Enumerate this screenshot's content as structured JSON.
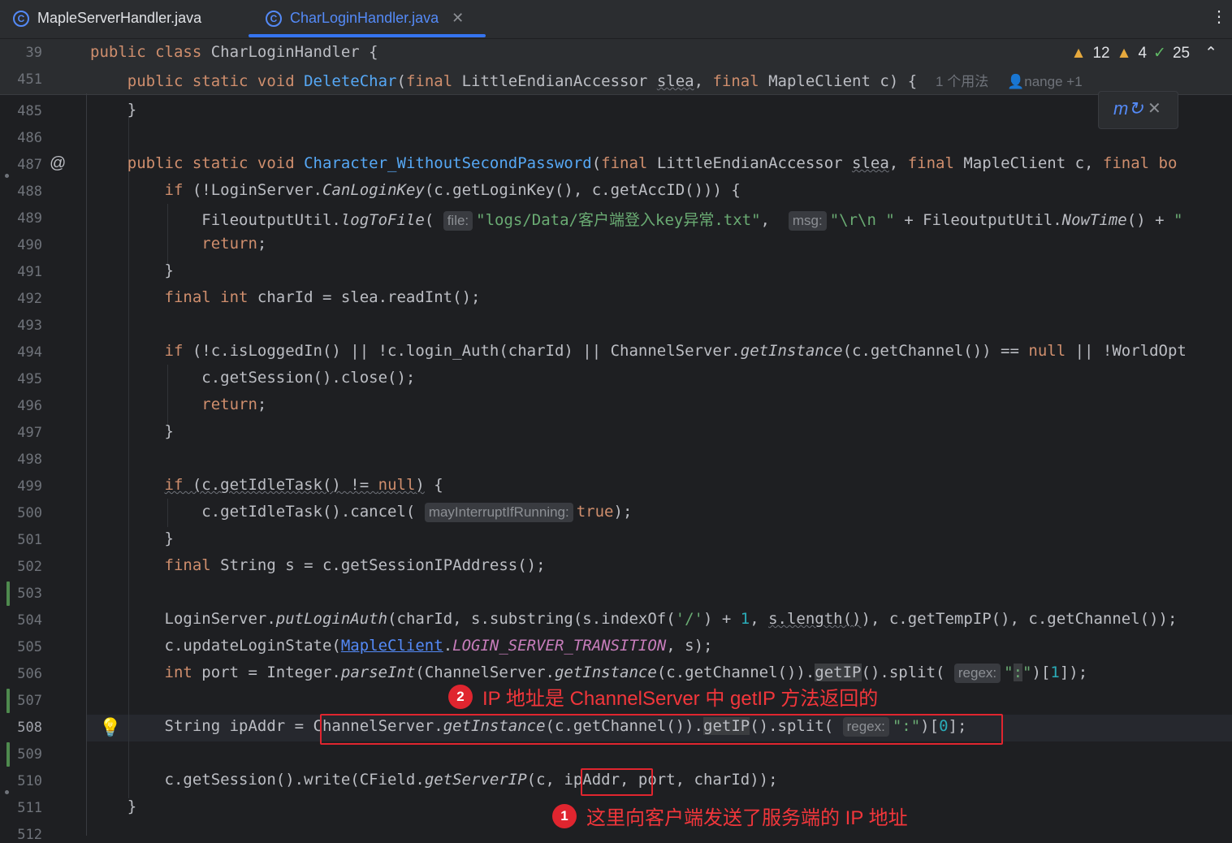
{
  "tabs": [
    {
      "label": "MapleServerHandler.java",
      "icon": "class-icon",
      "active": false
    },
    {
      "label": "CharLoginHandler.java",
      "icon": "class-icon",
      "active": true
    }
  ],
  "inspections": {
    "warnings": "12",
    "weak_warnings": "4",
    "ok": "25"
  },
  "usage_hint": "1 个用法",
  "author_hint": "nange +1",
  "line_numbers": {
    "l39": "39",
    "l451": "451",
    "l485": "485",
    "l486": "486",
    "l487": "487",
    "l488": "488",
    "l489": "489",
    "l490": "490",
    "l491": "491",
    "l492": "492",
    "l493": "493",
    "l494": "494",
    "l495": "495",
    "l496": "496",
    "l497": "497",
    "l498": "498",
    "l499": "499",
    "l500": "500",
    "l501": "501",
    "l502": "502",
    "l503": "503",
    "l504": "504",
    "l505": "505",
    "l506": "506",
    "l507": "507",
    "l508": "508",
    "l509": "509",
    "l510": "510",
    "l511": "511",
    "l512": "512"
  },
  "hints": {
    "file": "file:",
    "msg": "msg:",
    "may": "mayInterruptIfRunning:",
    "regex": "regex:"
  },
  "annotations": {
    "one_num": "1",
    "one_text": "这里向客户端发送了服务端的 IP 地址",
    "two_num": "2",
    "two_text": "IP 地址是 ChannelServer 中 getIP 方法返回的"
  },
  "colors": {
    "accent": "#548af7",
    "annotation": "#e0252f",
    "keyword": "#cf8e6d",
    "string": "#6aab73"
  }
}
